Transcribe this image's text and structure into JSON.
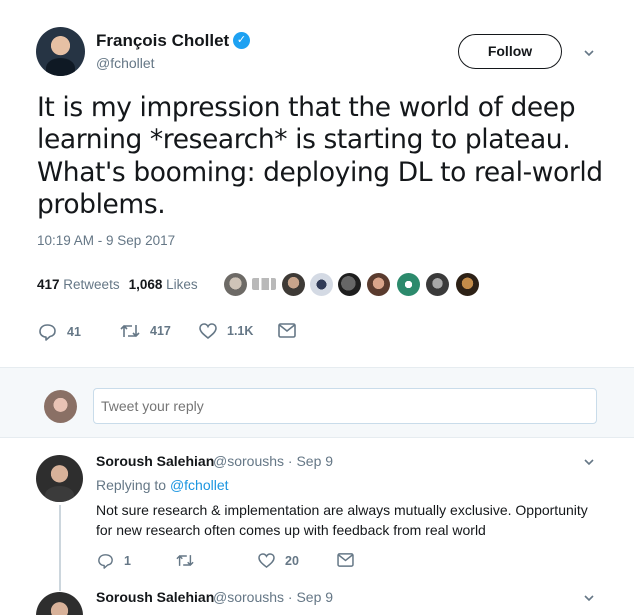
{
  "tweet": {
    "author_name": "François Chollet",
    "author_handle": "@fchollet",
    "verified_glyph": "✓",
    "follow_label": "Follow",
    "text": "It is my impression that the world of deep learning *research* is starting to plateau. What's booming: deploying DL to real-world problems.",
    "timestamp": "10:19 AM - 9 Sep 2017",
    "retweets_count": "417",
    "retweets_label": "Retweets",
    "likes_count": "1,068",
    "likes_label": "Likes",
    "actions": {
      "replies": "41",
      "retweets": "417",
      "likes": "1.1K"
    }
  },
  "reply_box": {
    "placeholder": "Tweet your reply"
  },
  "replies": [
    {
      "name": "Soroush Salehian",
      "handle_date": "@soroushs · Sep 9",
      "replying_prefix": "Replying to",
      "replying_to": "@fchollet",
      "text": "Not sure research & implementation are always mutually exclusive. Opportunity for new research often comes up with feedback from real world",
      "replies": "1",
      "likes": "20"
    },
    {
      "name": "Soroush Salehian",
      "handle_date": "@soroushs · Sep 9"
    }
  ],
  "colors": {
    "accent": "#1da1f2",
    "link": "#1b95e0",
    "muted": "#657786",
    "text": "#14171a",
    "reply_bar_bg": "#f5f8fa"
  },
  "icons": [
    "verified-icon",
    "chevron-down-icon",
    "reply-icon",
    "retweet-icon",
    "like-icon",
    "message-icon"
  ]
}
